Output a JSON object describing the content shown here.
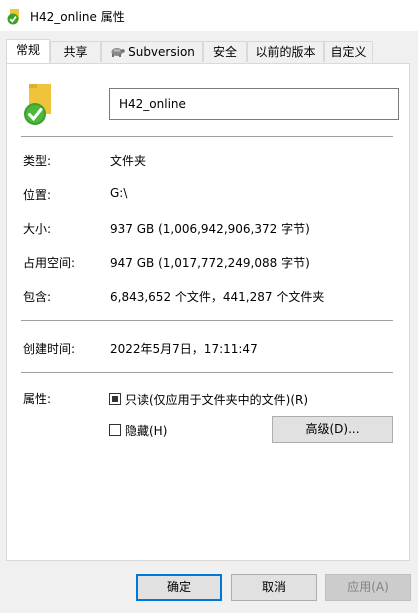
{
  "window": {
    "title": "H42_online 属性"
  },
  "tabs": [
    {
      "label": "常规",
      "active": true
    },
    {
      "label": "共享"
    },
    {
      "label": "Subversion",
      "icon": "subversion-turtle-icon"
    },
    {
      "label": "安全"
    },
    {
      "label": "以前的版本"
    },
    {
      "label": "自定义"
    }
  ],
  "general": {
    "name_value": "H42_online",
    "type_label": "类型:",
    "type_value": "文件夹",
    "location_label": "位置:",
    "location_value": "G:\\",
    "size_label": "大小:",
    "size_value": "937 GB (1,006,942,906,372 字节)",
    "size_on_disk_label": "占用空间:",
    "size_on_disk_value": "947 GB (1,017,772,249,088 字节)",
    "contains_label": "包含:",
    "contains_value": "6,843,652 个文件，441,287 个文件夹",
    "created_label": "创建时间:",
    "created_value": "2022年5月7日，17:11:47",
    "attributes_label": "属性:",
    "readonly_label": "只读(仅应用于文件夹中的文件)(R)",
    "readonly_state": "indeterminate",
    "hidden_label": "隐藏(H)",
    "hidden_checked": false,
    "advanced_label": "高级(D)..."
  },
  "footer": {
    "ok_label": "确定",
    "cancel_label": "取消",
    "apply_label": "应用(A)"
  },
  "colors": {
    "accent": "#0078d7",
    "folder_yellow": "#f0c33c",
    "overlay_green": "#3aa12a"
  }
}
